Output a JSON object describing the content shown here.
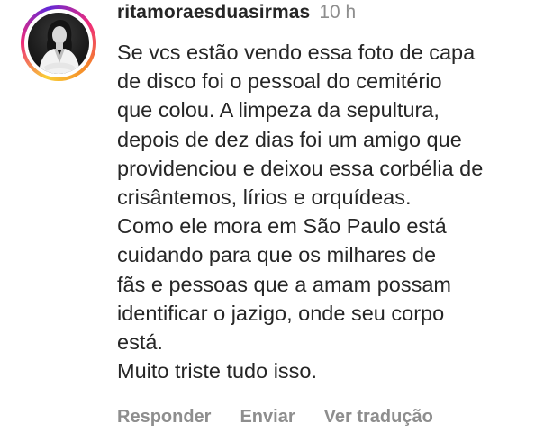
{
  "comment": {
    "username": "ritamoraesduasirmas",
    "timestamp": "10 h",
    "text_lines": [
      "Se vcs estão vendo essa foto de capa",
      "de disco foi o pessoal do cemitério",
      "que colou. A limpeza da sepultura,",
      "depois de dez dias foi um amigo que",
      "providenciou e deixou essa corbélia de",
      "crisântemos, lírios e orquídeas.",
      "Como ele mora em São Paulo está",
      "cuidando para que os milhares de",
      "fãs e pessoas que a amam possam",
      "identificar o jazigo, onde seu corpo",
      "está.",
      "Muito triste tudo isso."
    ],
    "actions": {
      "reply_label": "Responder",
      "send_label": "Enviar",
      "translate_label": "Ver tradução"
    },
    "avatar_icon": "profile-photo-icon",
    "colors": {
      "text": "#262626",
      "secondary": "#8e8e8e",
      "story_ring": [
        "#f9ce34",
        "#ee2a7b",
        "#6228d7"
      ]
    }
  }
}
